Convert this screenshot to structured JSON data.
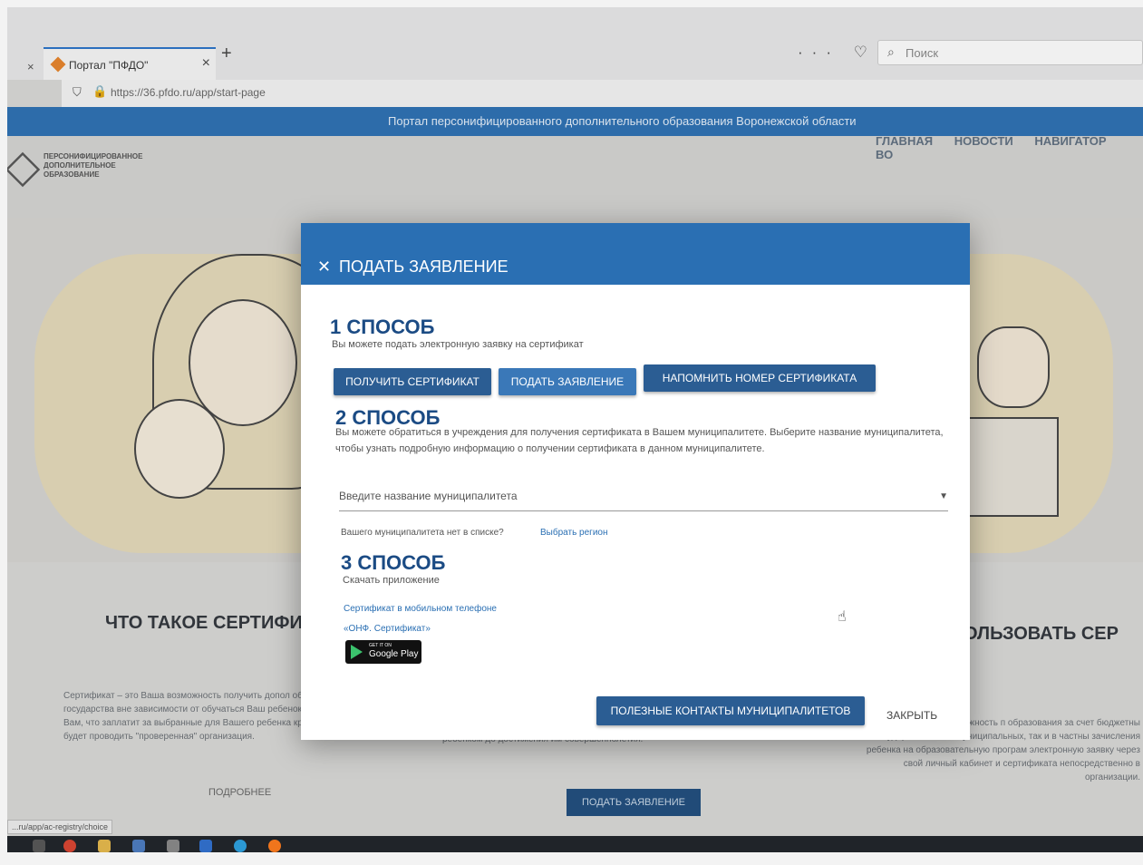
{
  "browser": {
    "prev_tab_icon": "close-icon",
    "tab_title": "Портал \"ПФДО\"",
    "new_tab": "+",
    "url": "https://36.pfdo.ru/app/start-page",
    "search_placeholder": "Поиск",
    "toolbar_icons": "··· ♡ ☆"
  },
  "site": {
    "banner": "Портал персонифицированного дополнительного образования Воронежской области",
    "logo_text": "ПЕРСОНИФИЦИРОВАННОЕ ДОПОЛНИТЕЛЬНОЕ ОБРАЗОВАНИЕ",
    "nav": [
      "ГЛАВНАЯ",
      "НОВОСТИ",
      "НАВИГАТОР",
      "ВО"
    ]
  },
  "background": {
    "left_title": "ЧТО ТАКОЕ СЕРТИФИК",
    "right_title": "ОЛЬЗОВАТЬ СЕР",
    "left_text": "Сертификат – это Ваша возможность получить допол образование за счет государства вне зависимости от обучаться Ваш ребенок. Государство гарантирует Вам, что заплатит за выбранные для Вашего ребенка кружки или секции, если их будет проводить \"проверенная\" организация.",
    "mid_text": "ребенком до достижения им совершеннолетия.",
    "right_text": "оставляет детям возможность п образования за счет бюджетны государственных и муниципальных, так и в частны зачисления ребенка на образовательную програм электронную заявку через свой личный кабинет и сертификата непосредственно в организации.",
    "more_link": "ПОДРОБНЕЕ",
    "apply_button": "ПОДАТЬ ЗАЯВЛЕНИЕ",
    "status_url": "...ru/app/ac-registry/choice"
  },
  "modal": {
    "title": "ПОДАТЬ ЗАЯВЛЕНИЕ",
    "way1": {
      "heading": "1 СПОСОБ",
      "subtitle": "Вы можете подать электронную заявку на сертификат",
      "buttons": [
        "ПОЛУЧИТЬ СЕРТИФИКАТ",
        "ПОДАТЬ ЗАЯВЛЕНИЕ",
        "НАПОМНИТЬ НОМЕР СЕРТИФИКАТА"
      ]
    },
    "way2": {
      "heading": "2 СПОСОБ",
      "description": "Вы можете обратиться в учреждения для получения сертификата в Вашем муниципалитете. Выберите название муниципалитета, чтобы узнать подробную информацию о получении сертификата в данном муниципалитете.",
      "select_placeholder": "Введите название муниципалитета",
      "region_question": "Вашего муниципалитета нет в списке?",
      "region_link": "Выбрать регион"
    },
    "way3": {
      "heading": "3 СПОСОБ",
      "subtitle": "Скачать приложение",
      "link1": "Сертификат в мобильном телефоне",
      "link2": "«ОНФ. Сертификат»",
      "gplay_small": "GET IT ON",
      "gplay_big": "Google Play"
    },
    "footer_button": "ПОЛЕЗНЫЕ КОНТАКТЫ МУНИЦИПАЛИТЕТОВ",
    "close_link": "ЗАКРЫТЬ"
  }
}
